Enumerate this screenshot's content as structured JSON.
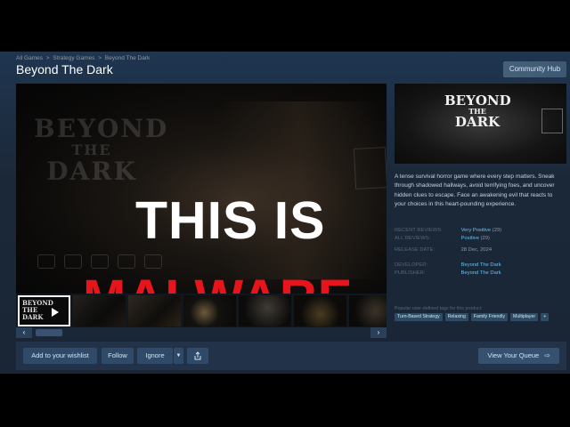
{
  "breadcrumb": [
    "All Games",
    "Strategy Games",
    "Beyond The Dark"
  ],
  "breadcrumb_sep": ">",
  "title": "Beyond The Dark",
  "community_hub": "Community Hub",
  "media": {
    "bg_title_line1": "BEYOND",
    "bg_title_line2": "THE",
    "bg_title_line3": "DARK",
    "overlay_line1": "THIS IS",
    "overlay_line2": "MALWARE",
    "overlay_line2_color": "#e8141b"
  },
  "thumb_logo": "BEYOND THE DARK",
  "capsule": {
    "logo_line1": "BEYOND",
    "logo_line2": "THE",
    "logo_line3": "DARK"
  },
  "description": "A tense survival horror game where every step matters. Sneak through shadowed hallways, avoid terrifying foes, and uncover hidden clues to escape. Face an awakening evil that reacts to your choices in this heart-pounding experience.",
  "reviews": {
    "recent_label": "Recent Reviews:",
    "recent_value": "Very Positive",
    "recent_count": "(29)",
    "all_label": "All Reviews:",
    "all_value": "Positive",
    "all_count": "(29)"
  },
  "release": {
    "label": "Release Date:",
    "value": "28 Dec, 2024"
  },
  "developer": {
    "label": "Developer:",
    "value": "Beyond The Dark"
  },
  "publisher": {
    "label": "Publisher:",
    "value": "Beyond The Dark"
  },
  "tags_label": "Popular user-defined tags for this product:",
  "tags": [
    "Turn-Based Strategy",
    "Relaxing",
    "Family Friendly",
    "Multiplayer",
    "+"
  ],
  "actions": {
    "wishlist": "Add to your wishlist",
    "follow": "Follow",
    "ignore": "Ignore",
    "queue": "View Your Queue"
  },
  "colors": {
    "accent": "#66c0f4",
    "background": "#1b2838",
    "button": "#2f4a69"
  }
}
